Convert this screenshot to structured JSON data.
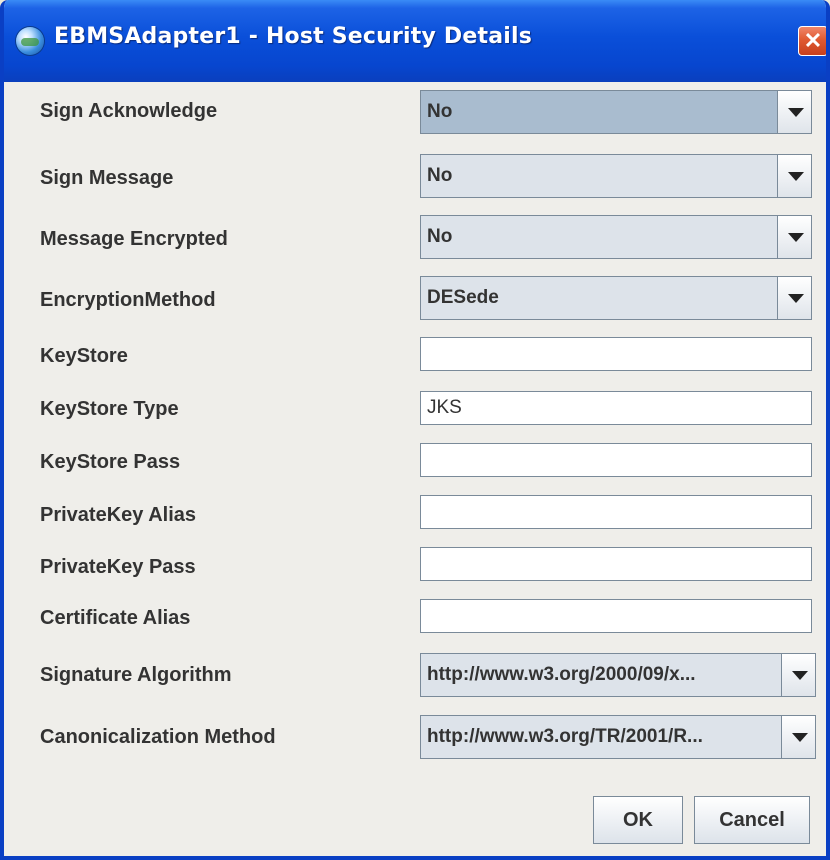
{
  "window": {
    "title": "EBMSAdapter1 - Host Security Details"
  },
  "fields": {
    "sign_acknowledge": {
      "label": "Sign Acknowledge",
      "value": "No"
    },
    "sign_message": {
      "label": "Sign Message",
      "value": "No"
    },
    "message_encrypted": {
      "label": "Message Encrypted",
      "value": "No"
    },
    "encryption_method": {
      "label": "EncryptionMethod",
      "value": "DESede"
    },
    "keystore": {
      "label": "KeyStore",
      "value": ""
    },
    "keystore_type": {
      "label": "KeyStore Type",
      "value": "JKS"
    },
    "keystore_pass": {
      "label": "KeyStore Pass",
      "value": ""
    },
    "privatekey_alias": {
      "label": "PrivateKey Alias",
      "value": ""
    },
    "privatekey_pass": {
      "label": "PrivateKey Pass",
      "value": ""
    },
    "certificate_alias": {
      "label": "Certificate Alias",
      "value": ""
    },
    "signature_algorithm": {
      "label": "Signature Algorithm",
      "value": "http://www.w3.org/2000/09/x..."
    },
    "canonicalization_method": {
      "label": "Canonicalization Method",
      "value": "http://www.w3.org/TR/2001/R..."
    }
  },
  "buttons": {
    "ok": "OK",
    "cancel": "Cancel"
  },
  "icons": {
    "title": "globe-app-icon",
    "close": "close-icon",
    "dropdown": "chevron-down-icon"
  },
  "colors": {
    "titlebar": "#0a4fd9",
    "close": "#e05a32",
    "background": "#efeeea"
  }
}
